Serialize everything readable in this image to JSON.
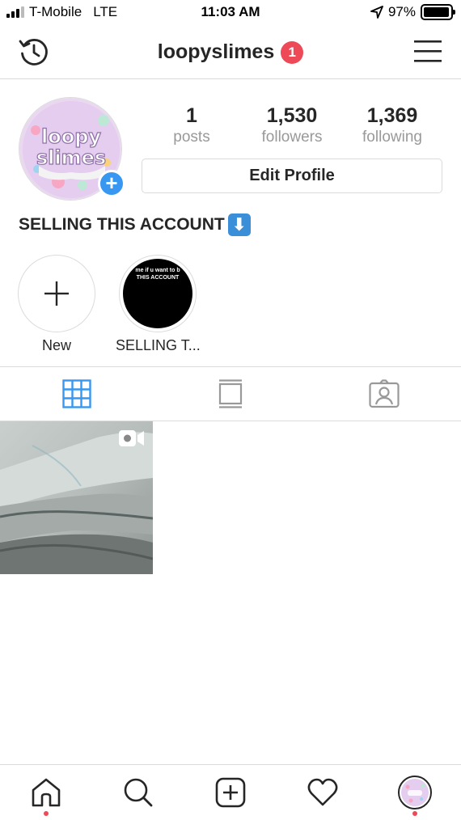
{
  "status_bar": {
    "carrier": "T-Mobile",
    "network": "LTE",
    "time": "11:03 AM",
    "battery_percent": "97%",
    "battery_level": 0.97
  },
  "nav": {
    "username": "loopyslimes",
    "notification_count": "1",
    "left_icon": "history-icon",
    "right_icon": "menu-icon"
  },
  "profile": {
    "avatar_text": "loopy slimes",
    "stats": [
      {
        "value": "1",
        "label": "posts"
      },
      {
        "value": "1,530",
        "label": "followers"
      },
      {
        "value": "1,369",
        "label": "following"
      }
    ],
    "edit_button": "Edit Profile",
    "bio": "SELLING THIS ACCOUNT",
    "bio_emoji": "⬇"
  },
  "highlights": [
    {
      "label": "New",
      "icon": "plus-icon"
    },
    {
      "label": "SELLING T...",
      "cover_text_line1": "me if u want to b",
      "cover_text_line2": "THIS ACCOUNT"
    }
  ],
  "tabs": [
    {
      "name": "grid",
      "icon": "grid-icon",
      "active": true
    },
    {
      "name": "feed",
      "icon": "feed-icon",
      "active": false
    },
    {
      "name": "tagged",
      "icon": "tagged-icon",
      "active": false
    }
  ],
  "posts": [
    {
      "type": "video",
      "icon": "video-icon"
    }
  ],
  "bottom_nav": [
    {
      "name": "home",
      "icon": "home-icon",
      "has_dot": true
    },
    {
      "name": "search",
      "icon": "search-icon",
      "has_dot": false
    },
    {
      "name": "new-post",
      "icon": "add-post-icon",
      "has_dot": false
    },
    {
      "name": "activity",
      "icon": "heart-icon",
      "has_dot": false
    },
    {
      "name": "profile",
      "icon": "profile-avatar",
      "has_dot": true
    }
  ],
  "colors": {
    "accent_blue": "#3897f0",
    "badge_red": "#ed4956",
    "text": "#262626",
    "secondary_text": "#999999",
    "divider": "#dbdbdb"
  }
}
